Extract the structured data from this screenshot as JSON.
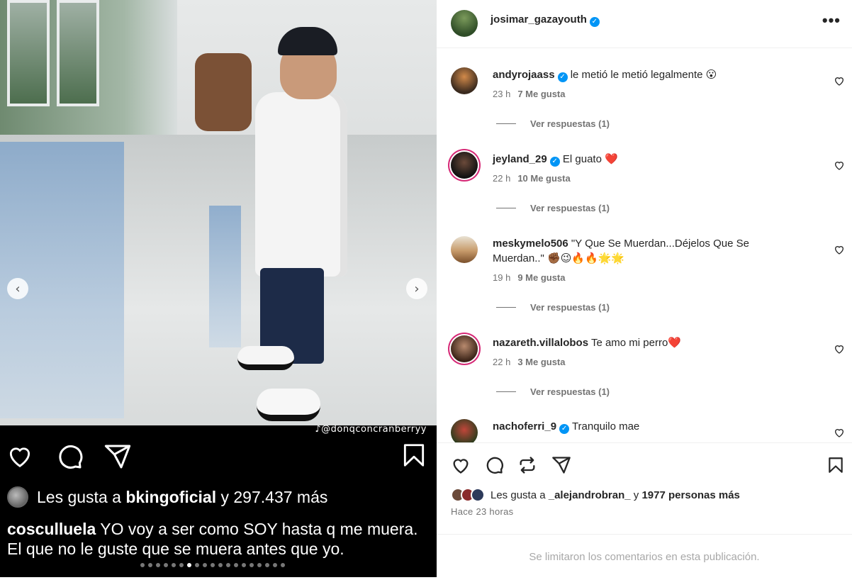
{
  "media": {
    "watermark": "@donqconcranberryy",
    "left_overlay": {
      "likes_prefix": "Les gusta a",
      "likes_user": "bkingoficial",
      "likes_suffix": "y 297.437 más",
      "caption_user": "cosculluela",
      "caption_text": "YO voy a ser como SOY hasta q me muera. El que no le guste que se muera antes que yo."
    },
    "carousel": {
      "total": 19,
      "active_index": 6
    },
    "prev_icon": "chevron-left-icon",
    "next_icon": "chevron-right-icon"
  },
  "post": {
    "owner": "josimar_gazayouth",
    "more_icon": "more-horizontal-icon",
    "comments": [
      {
        "user": "andyrojaass",
        "verified": true,
        "text": "le metió le metió legalmente 😮",
        "time": "23 h",
        "likes": "7 Me gusta",
        "replies": "Ver respuestas (1)"
      },
      {
        "user": "jeyland_29",
        "verified": true,
        "text": "El guato ❤️",
        "time": "22 h",
        "likes": "10 Me gusta",
        "replies": "Ver respuestas (1)"
      },
      {
        "user": "meskymelo506",
        "verified": false,
        "text": "\"Y Que Se Muerdan...Déjelos Que Se Muerdan..\" ✊🏾😉🔥🔥🌟🌟",
        "time": "19 h",
        "likes": "9 Me gusta",
        "replies": "Ver respuestas (1)"
      },
      {
        "user": "nazareth.villalobos",
        "verified": false,
        "text": "Te amo mi perro❤️",
        "time": "22 h",
        "likes": "3 Me gusta",
        "replies": "Ver respuestas (1)"
      },
      {
        "user": "nachoferri_9",
        "verified": true,
        "text": "Tranquilo mae",
        "time": "",
        "likes": "",
        "replies": ""
      }
    ],
    "likes_prefix": "Les gusta a",
    "likes_user": "_alejandrobran_",
    "likes_mid": "y",
    "likes_count": "1977 personas más",
    "time_ago": "Hace 23 horas",
    "comments_limited": "Se limitaron los comentarios en esta publicación."
  },
  "colors": {
    "accent": "#0095f6",
    "story_ring": "#d62976",
    "muted": "#737373"
  }
}
